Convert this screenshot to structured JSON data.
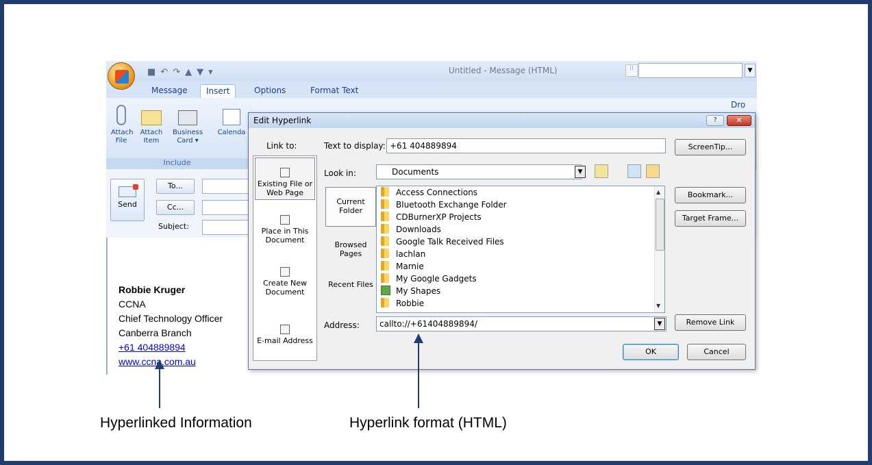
{
  "outlook": {
    "window_title": "Untitled - Message (HTML)",
    "tabs": [
      "Message",
      "Insert",
      "Options",
      "Format Text"
    ],
    "active_tab": "Insert",
    "ribbon": {
      "attach_file": "Attach File",
      "attach_item": "Attach Item",
      "business_card": "Business Card ▾",
      "calendar": "Calenda",
      "group_include": "Include",
      "right_partial": "Dro"
    },
    "send_label": "Send",
    "to_button": "To...",
    "cc_button": "Cc...",
    "subject_label": "Subject:"
  },
  "signature": {
    "name": "Robbie Kruger",
    "line1": "CCNA",
    "line2": "Chief Technology Officer",
    "line3": "Canberra Branch",
    "phone_link": "+61 404889894",
    "web_link": "www.ccna.com.au"
  },
  "dialog": {
    "title": "Edit Hyperlink",
    "help_glyph": "?",
    "close_glyph": "✕",
    "link_to_label": "Link to:",
    "link_to_items": [
      "Existing File or Web Page",
      "Place in This Document",
      "Create New Document",
      "E-mail Address"
    ],
    "text_to_display_label": "Text to display:",
    "text_to_display_value": "+61 404889894",
    "screentip_button": "ScreenTip...",
    "look_in_label": "Look in:",
    "look_in_value": "Documents",
    "subnav": [
      "Current Folder",
      "Browsed Pages",
      "Recent Files"
    ],
    "files": [
      {
        "name": "Access Connections",
        "icon": "folder-icon"
      },
      {
        "name": "Bluetooth Exchange Folder",
        "icon": "folder-icon"
      },
      {
        "name": "CDBurnerXP Projects",
        "icon": "folder-icon"
      },
      {
        "name": "Downloads",
        "icon": "folder-icon"
      },
      {
        "name": "Google Talk Received Files",
        "icon": "folder-icon"
      },
      {
        "name": "lachlan",
        "icon": "folder-icon"
      },
      {
        "name": "Marnie",
        "icon": "folder-icon"
      },
      {
        "name": "My Google Gadgets",
        "icon": "folder-icon"
      },
      {
        "name": "My Shapes",
        "icon": "shapes-icon"
      },
      {
        "name": "Robbie",
        "icon": "folder-icon"
      }
    ],
    "bookmark_button": "Bookmark...",
    "target_frame_button": "Target Frame...",
    "address_label": "Address:",
    "address_value": "callto://+61404889894/",
    "remove_link_button": "Remove Link",
    "ok_button": "OK",
    "cancel_button": "Cancel"
  },
  "annotations": {
    "left_caption": "Hyperlinked Information",
    "right_caption": "Hyperlink format (HTML)"
  },
  "colors": {
    "frame_border": "#1f3e6e",
    "link_blue": "#0000ee"
  }
}
